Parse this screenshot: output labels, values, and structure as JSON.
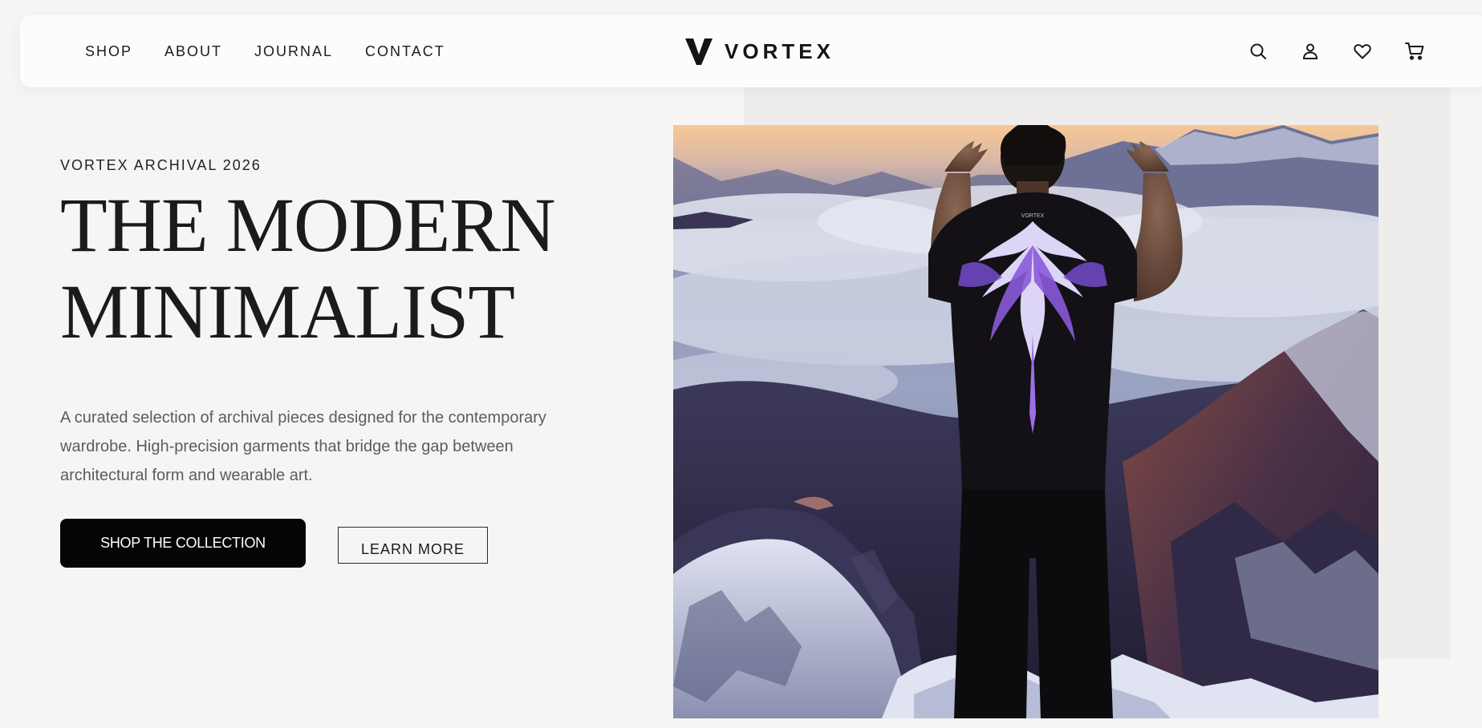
{
  "nav": {
    "links": [
      {
        "label": "SHOP"
      },
      {
        "label": "ABOUT"
      },
      {
        "label": "JOURNAL"
      },
      {
        "label": "CONTACT"
      }
    ],
    "logo_text": "VORTEX",
    "icons": [
      "search-icon",
      "account-icon",
      "heart-icon",
      "cart-icon"
    ]
  },
  "hero": {
    "eyebrow": "VORTEX ARCHIVAL 2026",
    "title_line1": "THE MODERN",
    "title_line2": "MINIMALIST",
    "description": "A curated selection of archival pieces designed for the contemporary wardrobe. High-precision garments that bridge the gap between architectural form and wearable art.",
    "primary_button": "SHOP THE COLLECTION",
    "secondary_button": "LEARN MORE",
    "shirt_print": "VORTEX"
  },
  "colors": {
    "background": "#f7f5f3",
    "accent_purple": "#7b4fd6",
    "button_dark": "#050505"
  }
}
